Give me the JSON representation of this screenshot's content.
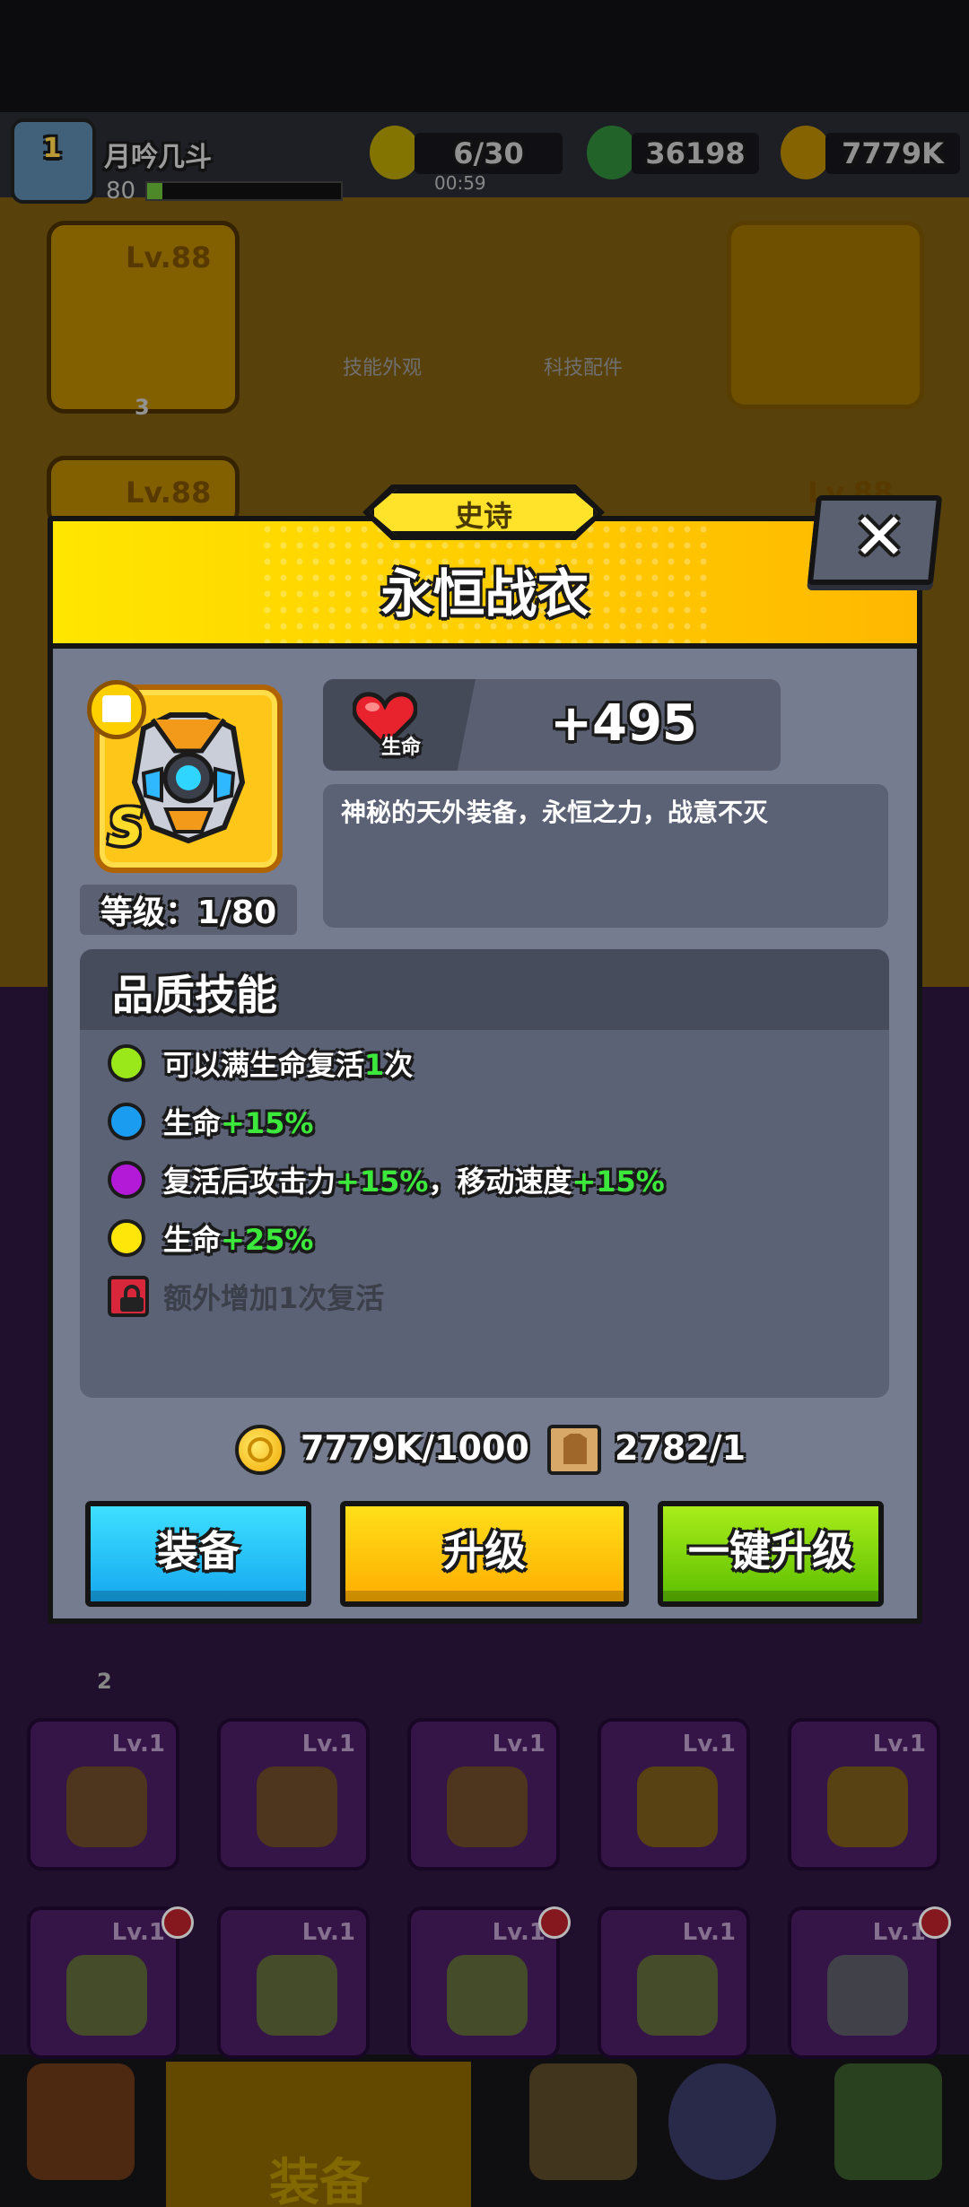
{
  "player": {
    "name": "月吟几斗",
    "level": "1",
    "xp_level": "80"
  },
  "resources": {
    "energy": "6/30",
    "energy_timer": "00:59",
    "gems": "36198",
    "gold": "7779K"
  },
  "background": {
    "weapon_card_level": "Lv.88",
    "weapon_card_count": "3",
    "second_card_level": "Lv.88",
    "second_card_right_level": "Lv.88",
    "skill_skin_label": "技能外观",
    "tech_parts_label": "科技配件",
    "row_count_badge": "2",
    "item_levels": [
      "Lv.1",
      "Lv.1",
      "Lv.1",
      "Lv.1",
      "Lv.1",
      "Lv.1",
      "Lv.1",
      "Lv.1",
      "Lv.1",
      "Lv.1"
    ],
    "nav_active_label": "装备"
  },
  "modal": {
    "rarity": "史诗",
    "title": "永恒战衣",
    "rank": "S",
    "level_label": "等级：1/80",
    "stat": {
      "name": "生命",
      "value": "+495"
    },
    "description": "神秘的天外装备，永恒之力，战意不灭",
    "skills_title": "品质技能",
    "skills": [
      {
        "color": "#9be81a",
        "prefix": "可以满生命复活",
        "highlight": "1",
        "suffix": "次",
        "highlight2": "",
        "suffix2": ""
      },
      {
        "color": "#1a9cf0",
        "prefix": "生命",
        "highlight": "+15%",
        "suffix": "",
        "highlight2": "",
        "suffix2": ""
      },
      {
        "color": "#b31ad8",
        "prefix": "复活后攻击力",
        "highlight": "+15%",
        "suffix": "，移动速度",
        "highlight2": "+15%",
        "suffix2": ""
      },
      {
        "color": "#ffe60a",
        "prefix": "生命",
        "highlight": "+25%",
        "suffix": "",
        "highlight2": "",
        "suffix2": ""
      }
    ],
    "locked_skill": "额外增加1次复活",
    "cost_gold": "7779K/1000",
    "cost_material": "2782/1",
    "buttons": {
      "equip": "装备",
      "upgrade": "升级",
      "upgrade_all": "一键升级"
    },
    "colors": {
      "header_yellow": "#ffd200",
      "panel": "#767c8f",
      "highlight_green": "#3be83b"
    }
  }
}
